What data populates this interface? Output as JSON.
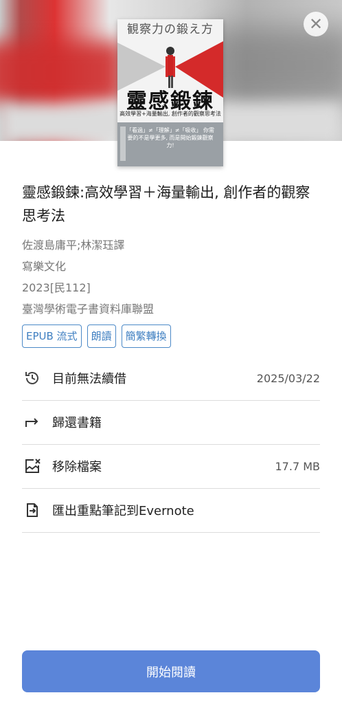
{
  "hero": {
    "close_icon": "close-icon"
  },
  "cover": {
    "top_title": "観察力の鍛え方",
    "big_title": "靈感鍛鍊",
    "subtitle": "高效學習+海量輸出, 創作者的觀察思考法",
    "band_text": "「看過」≠「理解」≠「吸收」 你需要的不是學更多, 而是開始鍛鍊觀察力!"
  },
  "book": {
    "title": "靈感鍛鍊:高效學習＋海量輸出, 創作者的觀察思考法",
    "author": "佐渡島庸平;林潔珏譯",
    "publisher": "寫樂文化",
    "year": "2023[民112]",
    "library": "臺灣學術電子書資料庫聯盟"
  },
  "tags": [
    "EPUB 流式",
    "朗讀",
    "簡繁轉換"
  ],
  "actions": [
    {
      "label": "目前無法續借",
      "value": "2025/03/22",
      "icon": "history-icon"
    },
    {
      "label": "歸還書籍",
      "value": "",
      "icon": "return-arrow-icon"
    },
    {
      "label": "移除檔案",
      "value": "17.7 MB",
      "icon": "remove-file-icon"
    },
    {
      "label": "匯出重點筆記到Evernote",
      "value": "",
      "icon": "export-icon"
    }
  ],
  "cta": {
    "label": "開始閱讀"
  },
  "colors": {
    "accent": "#5b85d9",
    "tag_border": "#4a88c7"
  }
}
